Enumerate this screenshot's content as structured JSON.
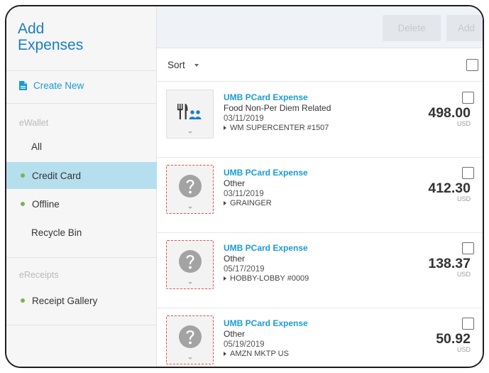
{
  "sidebar": {
    "title_line1": "Add",
    "title_line2": "Expenses",
    "create_new": "Create New",
    "ewallet_heading": "eWallet",
    "ereceipts_heading": "eReceipts",
    "items": [
      {
        "label": "All"
      },
      {
        "label": "Credit Card"
      },
      {
        "label": "Offline"
      },
      {
        "label": "Recycle Bin"
      },
      {
        "label": "Receipt Gallery"
      }
    ]
  },
  "toolbar": {
    "delete_label": "Delete",
    "add_label": "Add"
  },
  "sort": {
    "label": "Sort"
  },
  "expenses": [
    {
      "type": "UMB PCard Expense",
      "category": "Food Non-Per Diem Related",
      "date": "03/11/2019",
      "merchant": "WM SUPERCENTER #1507",
      "amount": "498.00",
      "currency": "USD",
      "icon": "meal-icon"
    },
    {
      "type": "UMB PCard Expense",
      "category": "Other",
      "date": "03/11/2019",
      "merchant": "GRAINGER",
      "amount": "412.30",
      "currency": "USD",
      "icon": "question-icon"
    },
    {
      "type": "UMB PCard Expense",
      "category": "Other",
      "date": "05/17/2019",
      "merchant": "HOBBY-LOBBY #0009",
      "amount": "138.37",
      "currency": "USD",
      "icon": "question-icon"
    },
    {
      "type": "UMB PCard Expense",
      "category": "Other",
      "date": "05/19/2019",
      "merchant": "AMZN MKTP US",
      "amount": "50.92",
      "currency": "USD",
      "icon": "question-icon"
    }
  ],
  "colors": {
    "accent": "#1a9bd7",
    "active_nav": "#b6dfee",
    "status_dot": "#79b54b",
    "missing_receipt_border": "#d55353"
  }
}
